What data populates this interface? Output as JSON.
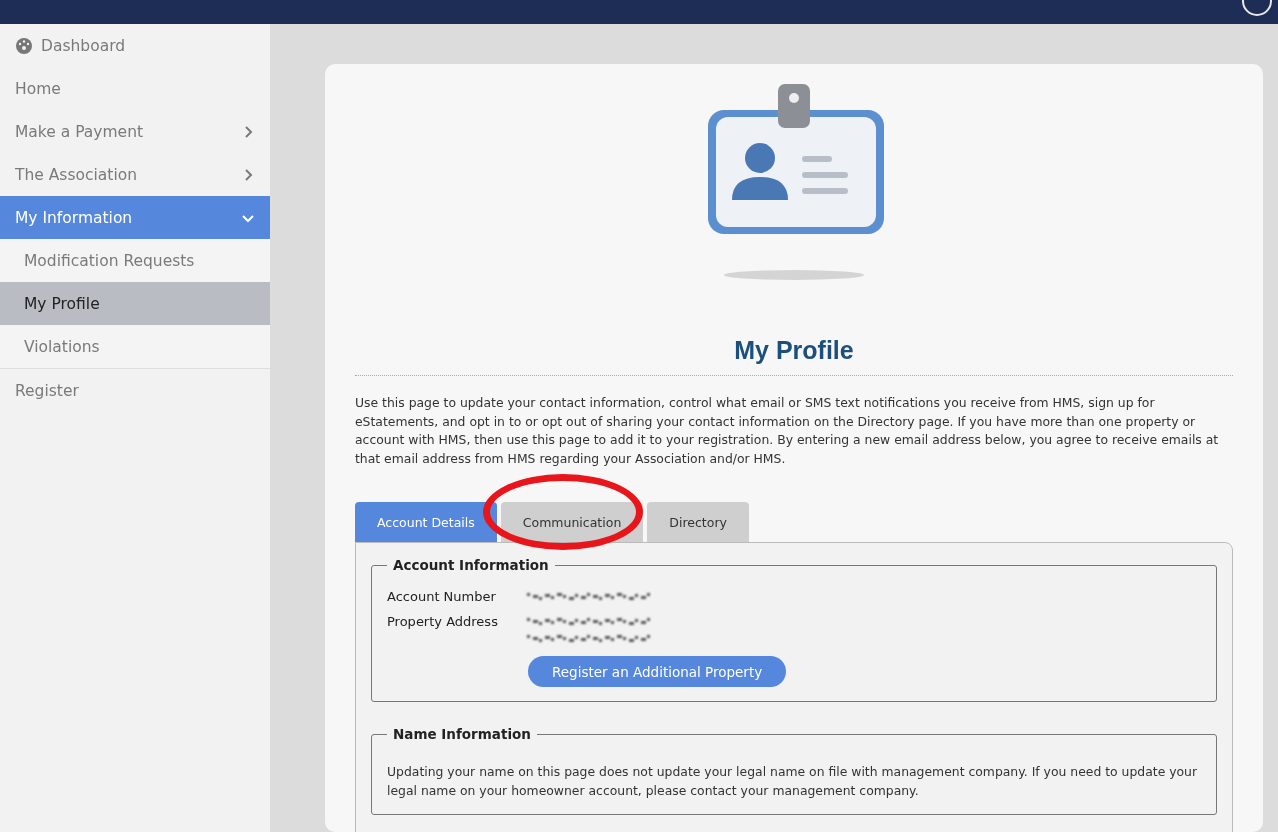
{
  "sidebar": {
    "items": [
      {
        "label": "Dashboard",
        "kind": "icon",
        "selected": false
      },
      {
        "label": "Home",
        "kind": "plain",
        "selected": false
      },
      {
        "label": "Make a Payment",
        "kind": "menu",
        "selected": false,
        "expanded": false
      },
      {
        "label": "The Association",
        "kind": "menu",
        "selected": false,
        "expanded": false
      },
      {
        "label": "My Information",
        "kind": "menu",
        "selected": true,
        "expanded": true,
        "children": [
          {
            "label": "Modification Requests",
            "selected": false
          },
          {
            "label": "My Profile",
            "selected": true
          },
          {
            "label": "Violations",
            "selected": false
          }
        ]
      },
      {
        "label": "Register",
        "kind": "plain",
        "selected": false
      }
    ]
  },
  "profile": {
    "title": "My Profile",
    "intro": "Use this page to update your contact information, control what email or SMS text notifications you receive from HMS, sign up for eStatements, and opt in to or opt out of sharing your contact information on the Directory page. If you have more than one property or account with HMS, then use this page to add it to your registration. By entering a new email address below, you agree to receive emails at that email address from HMS regarding your Association and/or HMS.",
    "tabs": [
      {
        "label": "Account Details",
        "selected": true
      },
      {
        "label": "Communication",
        "selected": false
      },
      {
        "label": "Directory",
        "selected": false
      }
    ],
    "account_information": {
      "legend": "Account Information",
      "fields": [
        {
          "label": "Account Number",
          "kind": "number"
        },
        {
          "label": "Property Address",
          "kind": "address"
        }
      ],
      "button": "Register an Additional Property"
    },
    "name_information": {
      "legend": "Name Information",
      "text": "Updating your name on this page does not update your legal name on file with management company. If you need to update your legal name on your homeowner account, please contact your management company."
    }
  }
}
